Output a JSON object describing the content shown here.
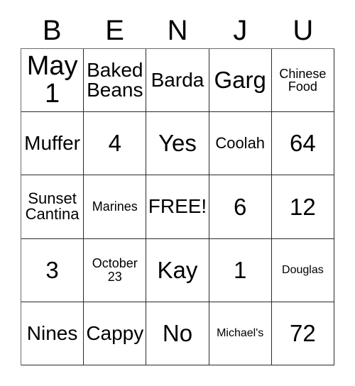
{
  "card": {
    "headers": [
      "B",
      "E",
      "N",
      "J",
      "U"
    ],
    "rows": [
      [
        {
          "text": "May\n1",
          "size": "fs-xl"
        },
        {
          "text": "Baked\nBeans",
          "size": "fs-md"
        },
        {
          "text": "Barda",
          "size": "fs-md"
        },
        {
          "text": "Garg",
          "size": "fs-lg"
        },
        {
          "text": "Chinese\nFood",
          "size": "fs-xs"
        }
      ],
      [
        {
          "text": "Muffer",
          "size": "fs-md"
        },
        {
          "text": "4",
          "size": "fs-lg"
        },
        {
          "text": "Yes",
          "size": "fs-lg"
        },
        {
          "text": "Coolah",
          "size": "fs-sm"
        },
        {
          "text": "64",
          "size": "fs-lg"
        }
      ],
      [
        {
          "text": "Sunset\nCantina",
          "size": "fs-sm"
        },
        {
          "text": "Marines",
          "size": "fs-xs"
        },
        {
          "text": "FREE!",
          "size": "fs-md"
        },
        {
          "text": "6",
          "size": "fs-lg"
        },
        {
          "text": "12",
          "size": "fs-lg"
        }
      ],
      [
        {
          "text": "3",
          "size": "fs-lg"
        },
        {
          "text": "October\n23",
          "size": "fs-xs"
        },
        {
          "text": "Kay",
          "size": "fs-lg"
        },
        {
          "text": "1",
          "size": "fs-lg"
        },
        {
          "text": "Douglas",
          "size": "fs-xxs"
        }
      ],
      [
        {
          "text": "Nines",
          "size": "fs-md"
        },
        {
          "text": "Cappy",
          "size": "fs-md"
        },
        {
          "text": "No",
          "size": "fs-lg"
        },
        {
          "text": "Michael's",
          "size": "fs-xxs"
        },
        {
          "text": "72",
          "size": "fs-lg"
        }
      ]
    ]
  },
  "colors": {
    "text": "#000000",
    "grid_line": "#2a2a2a",
    "background": "#ffffff"
  }
}
